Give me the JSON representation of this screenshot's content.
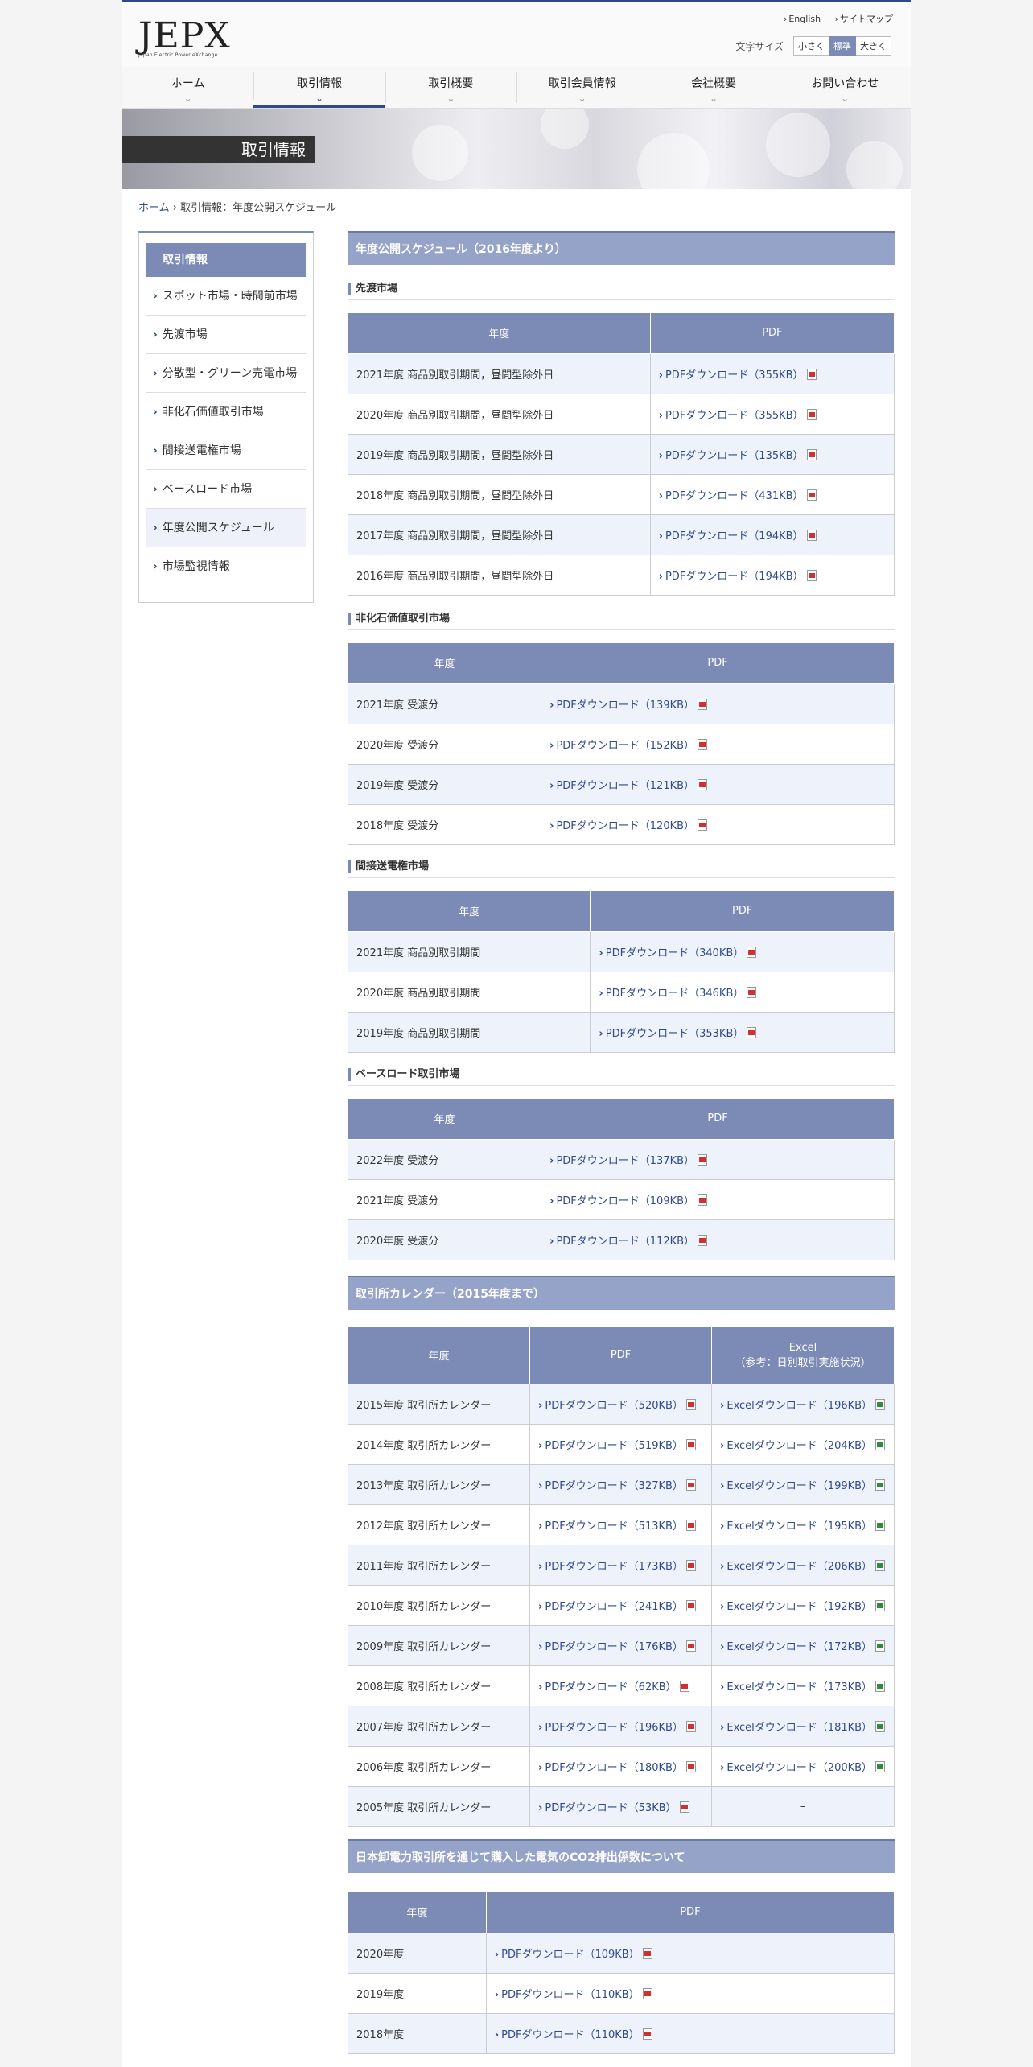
{
  "header": {
    "logo": "JEPX",
    "logo_sub": "Japan Electric Power eXchange",
    "links": [
      "English",
      "サイトマップ"
    ],
    "fontsize_label": "文字サイズ",
    "fontsize_options": [
      "小さく",
      "標準",
      "大きく"
    ],
    "fontsize_selected": "標準"
  },
  "nav": [
    "ホーム",
    "取引情報",
    "取引概要",
    "取引会員情報",
    "会社概要",
    "お問い合わせ"
  ],
  "nav_active": "取引情報",
  "banner_title": "取引情報",
  "breadcrumb": {
    "home": "ホーム",
    "sep": "›",
    "current": "取引情報：年度公開スケジュール"
  },
  "sidebar": {
    "title": "取引情報",
    "items": [
      "スポット市場・時間前市場",
      "先渡市場",
      "分散型・グリーン売電市場",
      "非化石価値取引市場",
      "間接送電権市場",
      "ベースロード市場",
      "年度公開スケジュール",
      "市場監視情報"
    ],
    "current": "年度公開スケジュール"
  },
  "section1": {
    "title": "年度公開スケジュール（2016年度より）",
    "forward": {
      "title": "先渡市場",
      "headers": [
        "年度",
        "PDF"
      ],
      "rows": [
        [
          "2021年度 商品別取引期間，昼間型除外日",
          "PDFダウンロード（355KB）"
        ],
        [
          "2020年度 商品別取引期間，昼間型除外日",
          "PDFダウンロード（355KB）"
        ],
        [
          "2019年度 商品別取引期間，昼間型除外日",
          "PDFダウンロード（135KB）"
        ],
        [
          "2018年度 商品別取引期間，昼間型除外日",
          "PDFダウンロード（431KB）"
        ],
        [
          "2017年度 商品別取引期間，昼間型除外日",
          "PDFダウンロード（194KB）"
        ],
        [
          "2016年度 商品別取引期間，昼間型除外日",
          "PDFダウンロード（194KB）"
        ]
      ]
    },
    "nonfossil": {
      "title": "非化石価値取引市場",
      "headers": [
        "年度",
        "PDF"
      ],
      "rows": [
        [
          "2021年度 受渡分",
          "PDFダウンロード（139KB）"
        ],
        [
          "2020年度 受渡分",
          "PDFダウンロード（152KB）"
        ],
        [
          "2019年度 受渡分",
          "PDFダウンロード（121KB）"
        ],
        [
          "2018年度 受渡分",
          "PDFダウンロード（120KB）"
        ]
      ]
    },
    "ftr": {
      "title": "間接送電権市場",
      "headers": [
        "年度",
        "PDF"
      ],
      "rows": [
        [
          "2021年度 商品別取引期間",
          "PDFダウンロード（340KB）"
        ],
        [
          "2020年度 商品別取引期間",
          "PDFダウンロード（346KB）"
        ],
        [
          "2019年度 商品別取引期間",
          "PDFダウンロード（353KB）"
        ]
      ]
    },
    "baseload": {
      "title": "ベースロード取引市場",
      "headers": [
        "年度",
        "PDF"
      ],
      "rows": [
        [
          "2022年度 受渡分",
          "PDFダウンロード（137KB）"
        ],
        [
          "2021年度 受渡分",
          "PDFダウンロード（109KB）"
        ],
        [
          "2020年度 受渡分",
          "PDFダウンロード（112KB）"
        ]
      ]
    }
  },
  "section2": {
    "title": "取引所カレンダー（2015年度まで）",
    "headers": [
      "年度",
      "PDF",
      "Excel",
      "（参考：日別取引実施状況）"
    ],
    "rows": [
      [
        "2015年度 取引所カレンダー",
        "PDFダウンロード（520KB）",
        "Excelダウンロード（196KB）"
      ],
      [
        "2014年度 取引所カレンダー",
        "PDFダウンロード（519KB）",
        "Excelダウンロード（204KB）"
      ],
      [
        "2013年度 取引所カレンダー",
        "PDFダウンロード（327KB）",
        "Excelダウンロード（199KB）"
      ],
      [
        "2012年度 取引所カレンダー",
        "PDFダウンロード（513KB）",
        "Excelダウンロード（195KB）"
      ],
      [
        "2011年度 取引所カレンダー",
        "PDFダウンロード（173KB）",
        "Excelダウンロード（206KB）"
      ],
      [
        "2010年度 取引所カレンダー",
        "PDFダウンロード（241KB）",
        "Excelダウンロード（192KB）"
      ],
      [
        "2009年度 取引所カレンダー",
        "PDFダウンロード（176KB）",
        "Excelダウンロード（172KB）"
      ],
      [
        "2008年度 取引所カレンダー",
        "PDFダウンロード（62KB）",
        "Excelダウンロード（173KB）"
      ],
      [
        "2007年度 取引所カレンダー",
        "PDFダウンロード（196KB）",
        "Excelダウンロード（181KB）"
      ],
      [
        "2006年度 取引所カレンダー",
        "PDFダウンロード（180KB）",
        "Excelダウンロード（200KB）"
      ],
      [
        "2005年度 取引所カレンダー",
        "PDFダウンロード（53KB）",
        "–"
      ]
    ]
  },
  "section3": {
    "title": "日本卸電力取引所を通じて購入した電気のCO2排出係数について",
    "headers": [
      "年度",
      "PDF"
    ],
    "rows": [
      [
        "2020年度",
        "PDFダウンロード（109KB）"
      ],
      [
        "2019年度",
        "PDFダウンロード（110KB）"
      ],
      [
        "2018年度",
        "PDFダウンロード（110KB）"
      ]
    ]
  },
  "icons": {
    "pdf": "pdf-icon",
    "excel": "excel-icon",
    "chevron": "chevron-down-icon",
    "arrow": "chevron-right-icon"
  },
  "colors": {
    "primary": "#2f4a8a",
    "table_header": "#7b8bb5",
    "section_bar": "#96a3c8",
    "row_alt": "#eef2fb"
  }
}
